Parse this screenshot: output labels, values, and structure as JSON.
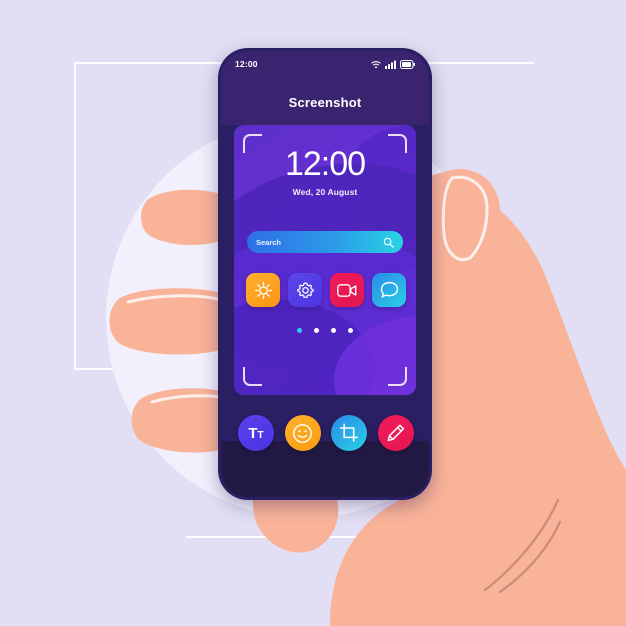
{
  "scene": {
    "description": "hand-holding-phone-screenshot-app-ui",
    "background_color": "#e2dff4",
    "skin_color": "#f9b398"
  },
  "phone": {
    "frame_color": "#2b1f63",
    "bottom_bar_color": "#221a45"
  },
  "status_bar": {
    "time": "12:00",
    "icons": [
      "wifi-icon",
      "signal-icon",
      "battery-icon"
    ]
  },
  "header": {
    "title": "Screenshot"
  },
  "wallpaper_card": {
    "clock": "12:00",
    "date": "Wed, 20 August",
    "capture_frame": true
  },
  "search": {
    "placeholder": "Search",
    "icon": "search-icon",
    "gradient_from": "#2e6fe8",
    "gradient_to": "#29d3e3"
  },
  "app_icons": [
    {
      "name": "brightness",
      "icon": "sun-icon",
      "color": "#ffb22e"
    },
    {
      "name": "settings",
      "icon": "gear-icon",
      "color": "#5a48ea"
    },
    {
      "name": "video",
      "icon": "video-camera-icon",
      "color": "#f21b5c"
    },
    {
      "name": "chat",
      "icon": "chat-bubble-icon",
      "color": "#2b8ae8"
    }
  ],
  "page_dots": {
    "count": 4,
    "active_index": 0,
    "active_color": "#2fd0ec",
    "inactive_color": "#ffffff"
  },
  "toolbar": [
    {
      "name": "text",
      "label": "Tt",
      "icon": "text-tool-icon",
      "color": "#5b42ee"
    },
    {
      "name": "emoji",
      "icon": "smiley-icon",
      "color": "#ffb22e"
    },
    {
      "name": "crop",
      "icon": "crop-icon",
      "color": "#2b8ae8"
    },
    {
      "name": "draw",
      "icon": "pencil-icon",
      "color": "#f21b5c"
    }
  ]
}
